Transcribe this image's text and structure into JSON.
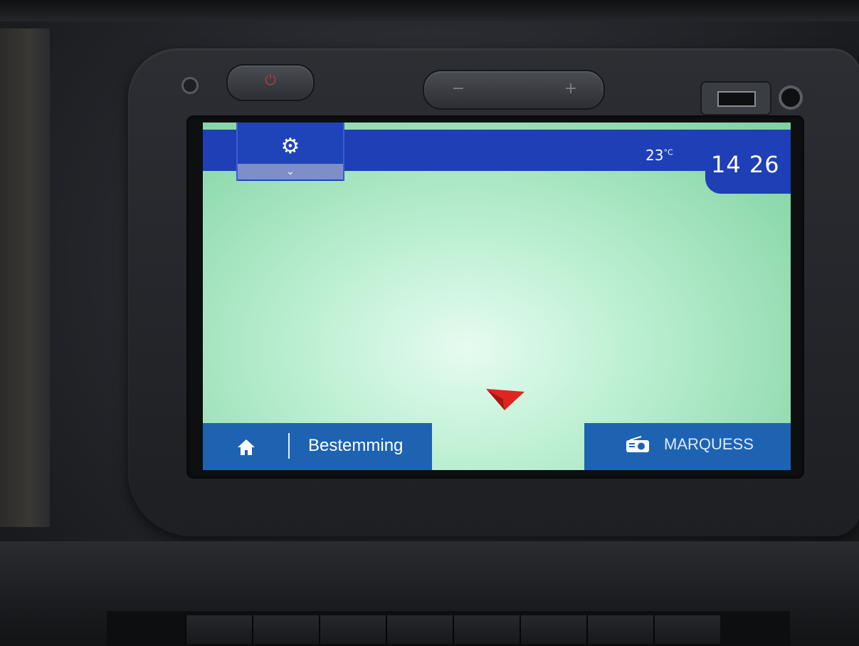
{
  "header": {
    "temperature": "23",
    "temperature_unit": "°C",
    "time": "14 26"
  },
  "settings_tab": {
    "icon": "gear-icon",
    "expand_icon": "chevron-down-icon"
  },
  "bottom_bar": {
    "home_icon": "home-icon",
    "destination_label": "Bestemming",
    "radio_icon": "radio-icon",
    "radio_station": "MARQUESS"
  },
  "map": {
    "position_marker": "navigation-arrow-icon",
    "marker_color": "#e0241f"
  },
  "colors": {
    "bar_blue": "#1e3fb6",
    "button_blue": "#1e63b1",
    "map_green": "#bdf0d3"
  }
}
